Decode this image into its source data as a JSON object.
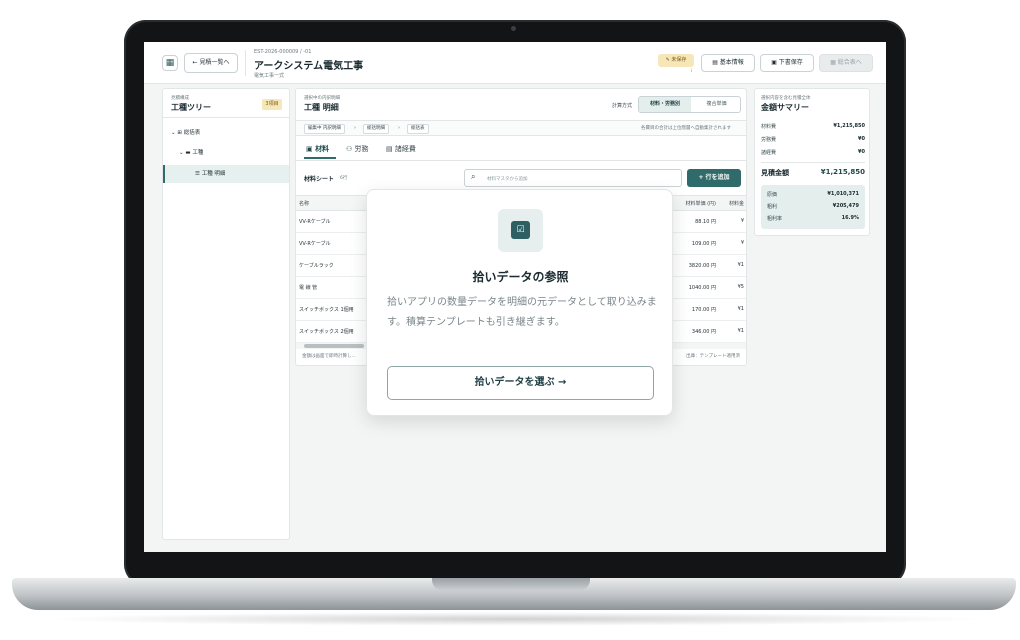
{
  "header": {
    "back_label": "← 見積一覧へ",
    "estimate_no": "EST-2026-000009 / -01",
    "title": "アークシステム電気工事",
    "subtitle": "電気工事一式",
    "unsaved_label": "✎ 未保存",
    "unsaved_hint": "i",
    "basic_info_label": "基本情報",
    "draft_save_label": "下書保存",
    "summary_label": "総合表へ"
  },
  "tree": {
    "caption": "見積構成",
    "title": "工種ツリー",
    "count_badge": "3項目",
    "items": [
      {
        "label": "総括表"
      },
      {
        "label": "工種"
      },
      {
        "label": "工種 明細"
      }
    ]
  },
  "center": {
    "caption": "選択中の内訳明細",
    "title": "工種 明細",
    "calc_label": "計算方式",
    "calc_options": [
      "材料・労務別",
      "複合単価"
    ],
    "breadcrumbs": [
      "編集中 内訳明細",
      "総括明細",
      "総括表"
    ],
    "crumb_note": "各費目の合計は上位階層へ自動集計されます",
    "tabs": [
      {
        "label": "材料"
      },
      {
        "label": "労務"
      },
      {
        "label": "諸経費"
      }
    ],
    "sheet_label": "材料シート",
    "sheet_count": "6行",
    "search_placeholder": "材料マスタから追加",
    "add_row_label": "+ 行を追加",
    "columns": {
      "name": "名称",
      "unit_price": "材料単価 (円)",
      "material": "材料金"
    },
    "rows": [
      {
        "name": "VV-Rケーブル",
        "price": "88.10 円",
        "mat": "¥"
      },
      {
        "name": "VV-Rケーブル",
        "price": "109.00 円",
        "mat": "¥"
      },
      {
        "name": "ケーブルラック",
        "price": "3820.00 円",
        "mat": "¥1"
      },
      {
        "name": "電 線 管",
        "price": "1040.00 円",
        "mat": "¥5"
      },
      {
        "name": "スイッチボックス 1個用",
        "price": "170.00 円",
        "mat": "¥1"
      },
      {
        "name": "スイッチボックス 2個用",
        "price": "346.00 円",
        "mat": "¥1"
      }
    ],
    "footer_left": "金額は画面で即時計算し...",
    "footer_right": "出庫：テンプレート適用済"
  },
  "summary": {
    "caption": "選択内容を含む見積全体",
    "title": "金額サマリー",
    "material": {
      "label": "材料費",
      "value": "¥1,215,850"
    },
    "labor": {
      "label": "労務費",
      "value": "¥0"
    },
    "overhead": {
      "label": "諸経費",
      "value": "¥0"
    },
    "total": {
      "label": "見積金額",
      "value": "¥1,215,850"
    },
    "cost": {
      "label": "原価",
      "value": "¥1,010,371"
    },
    "gross": {
      "label": "粗利",
      "value": "¥205,479"
    },
    "margin": {
      "label": "粗利率",
      "value": "16.9%"
    }
  },
  "modal": {
    "title": "拾いデータの参照",
    "description": "拾いアプリの数量データを明細の元データとして取り込みます。積算テンプレートも引き継ぎます。",
    "button_label": "拾いデータを選ぶ →"
  }
}
